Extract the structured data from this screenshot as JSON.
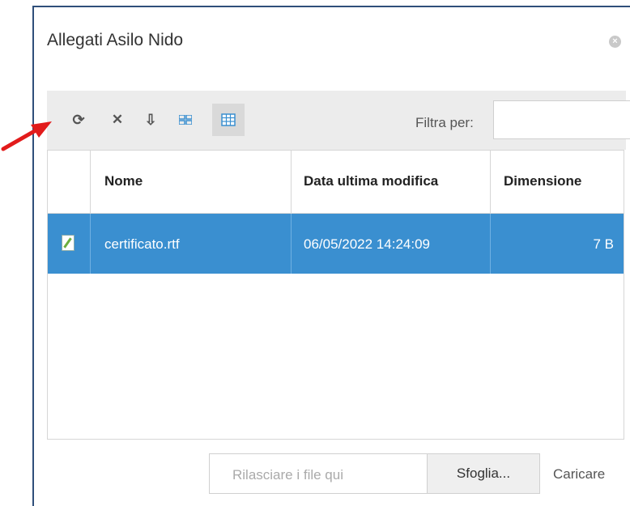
{
  "dialog": {
    "title": "Allegati Asilo Nido",
    "close_icon": "close-icon"
  },
  "toolbar": {
    "buttons": [
      {
        "name": "refresh-icon",
        "glyph": "⟳"
      },
      {
        "name": "delete-icon",
        "glyph": "✕"
      },
      {
        "name": "download-icon",
        "glyph": "⇩"
      },
      {
        "name": "grid-view-icon",
        "glyph": "▦"
      },
      {
        "name": "table-view-icon",
        "glyph": "▤"
      }
    ],
    "filter_label": "Filtra per:",
    "filter_value": ""
  },
  "grid": {
    "columns": [
      "Nome",
      "Data ultima modifica",
      "Dimensione"
    ],
    "rows": [
      {
        "name": "certificato.rtf",
        "modified": "06/05/2022 14:24:09",
        "size": "7 B",
        "selected": true
      }
    ]
  },
  "footer": {
    "drop_placeholder": "Rilasciare i file qui",
    "browse_label": "Sfoglia...",
    "upload_label": "Caricare"
  },
  "colors": {
    "selection": "#3a8fd0",
    "frame": "#2f4f7a",
    "annotation_arrow": "#e21b1b"
  }
}
